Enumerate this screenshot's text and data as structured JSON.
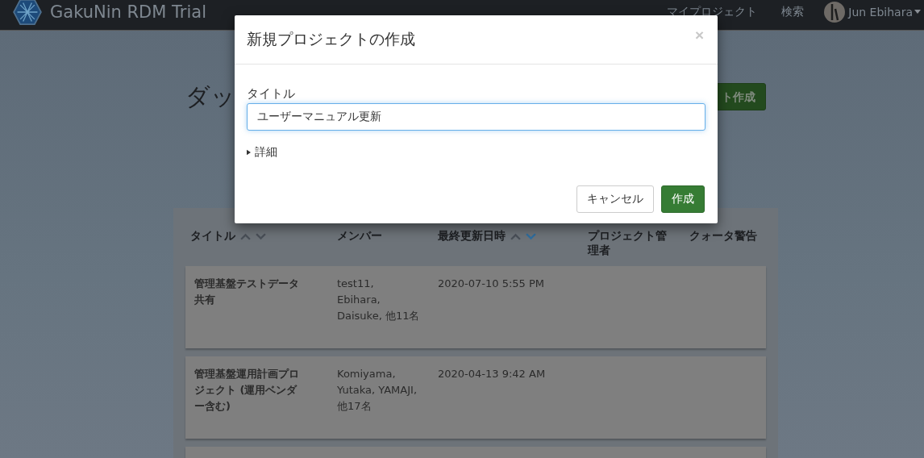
{
  "navbar": {
    "brand": "GakuNin RDM Trial",
    "links": [
      "マイプロジェクト",
      "検索"
    ],
    "user": "Jun Ebihara"
  },
  "dashboard": {
    "heading": "ダッ",
    "create_button": "ト作成"
  },
  "table": {
    "columns": [
      {
        "label": "タイトル",
        "sort_desc": false
      },
      {
        "label": "メンバー"
      },
      {
        "label": "最終更新日時",
        "sort_desc": true
      },
      {
        "label": "プロジェクト管理者"
      },
      {
        "label": "クォータ警告"
      }
    ],
    "rows": [
      {
        "title": "管理基盤テストデータ共有",
        "members": "test11, Ebihara, Daisuke, 他11名",
        "updated": "2020-07-10 5:55 PM"
      },
      {
        "title": "管理基盤運用計画プロジェクト (運用ベンダー含む)",
        "members": "Komiyama, Yutaka, YAMAJI, 他17名",
        "updated": "2020-04-13 9:42 AM"
      }
    ]
  },
  "modal": {
    "title": "新規プロジェクトの作成",
    "close": "×",
    "field_label": "タイトル",
    "value": "ユーザーマニュアル更新",
    "details": "詳細",
    "details_expanded": false,
    "buttons": [
      {
        "label": "キャンセル",
        "kind": "default"
      },
      {
        "label": "作成",
        "kind": "primary"
      }
    ]
  }
}
